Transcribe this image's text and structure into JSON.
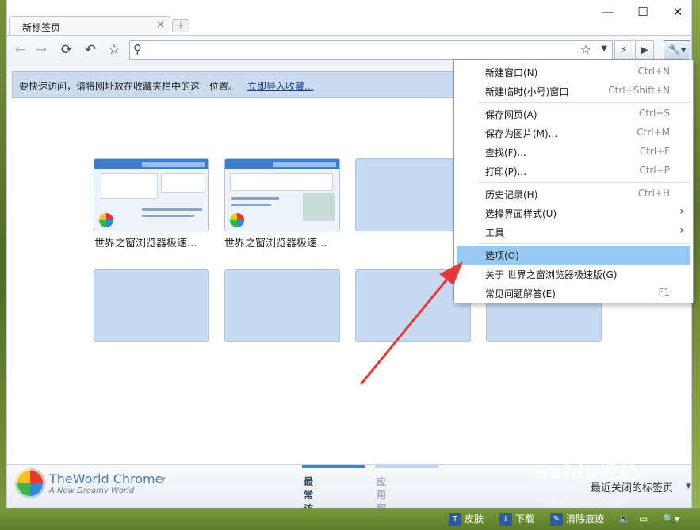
{
  "window": {
    "controls": {
      "minimize": "—",
      "maximize": "☐",
      "close": "✕"
    }
  },
  "tab": {
    "title": "新标签页",
    "close": "×",
    "new_tab": "+"
  },
  "toolbar": {
    "icons": [
      "back-icon",
      "forward-icon",
      "reload-icon",
      "undo-icon",
      "star-icon",
      "search-icon",
      "lightning-icon",
      "play-icon",
      "wrench-icon"
    ],
    "address_value": ""
  },
  "infobar": {
    "text": "要快速访问，请将网址放在收藏夹栏中的这一位置。",
    "link": "立即导入收藏..."
  },
  "thumbnails": [
    {
      "label": "世界之窗浏览器极速..."
    },
    {
      "label": "世界之窗浏览器极速..."
    }
  ],
  "footer": {
    "brand": "TheWorld Chrome",
    "slogan": "A New Dreamy World",
    "tabs": [
      "最常访问",
      "应用程序"
    ],
    "recently_closed": "最近关闭的标签页"
  },
  "statusbar": {
    "skin": "皮肤",
    "download": "下载",
    "clear": "清除痕迹"
  },
  "menu": {
    "items": [
      {
        "label": "新建窗口(N)",
        "shortcut": "Ctrl+N"
      },
      {
        "label": "新建临时(小号)窗口",
        "shortcut": "Ctrl+Shift+N"
      },
      {
        "label": "保存网页(A)",
        "shortcut": "Ctrl+S"
      },
      {
        "label": "保存为图片(M)...",
        "shortcut": "Ctrl+M"
      },
      {
        "label": "查找(F)...",
        "shortcut": "Ctrl+F"
      },
      {
        "label": "打印(P)...",
        "shortcut": "Ctrl+P"
      },
      {
        "label": "历史记录(H)",
        "shortcut": "Ctrl+H"
      },
      {
        "label": "选择界面样式(U)",
        "shortcut": ""
      },
      {
        "label": "工具",
        "shortcut": ""
      },
      {
        "label": "选项(O)",
        "shortcut": ""
      },
      {
        "label": "关于 世界之窗浏览器极速版(G)",
        "shortcut": ""
      },
      {
        "label": "常见问题解答(E)",
        "shortcut": "F1"
      }
    ]
  },
  "watermark": {
    "brand": "Baidu经验",
    "url": "jingyan.baidu.com"
  },
  "colors": {
    "accent": "#4a84cc",
    "menu_selected": "#99c9f2",
    "thumb_empty": "#c7daf2",
    "arrow": "#e8363a"
  }
}
